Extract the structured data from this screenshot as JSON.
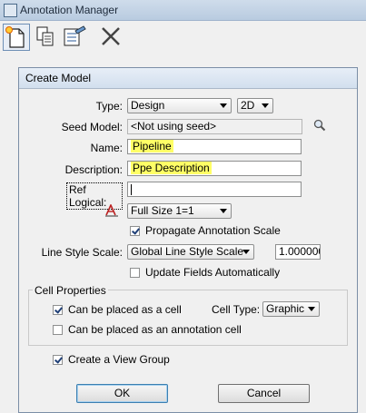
{
  "window": {
    "title": "Annotation Manager"
  },
  "toolbar": {
    "icons": [
      "new-model-icon",
      "copy-model-icon",
      "properties-icon",
      "delete-icon"
    ]
  },
  "dialog": {
    "title": "Create Model",
    "type": {
      "label": "Type:",
      "value": "Design",
      "dim": "2D"
    },
    "seed": {
      "label": "Seed Model:",
      "value": "<Not using seed>"
    },
    "name": {
      "label": "Name:",
      "value": "Pipeline"
    },
    "description": {
      "label": "Description:",
      "value": "Ppe Description"
    },
    "ref_logical": {
      "label": "Ref Logical:",
      "value": ""
    },
    "annotation_scale": {
      "value": "Full Size 1=1"
    },
    "propagate": {
      "label": "Propagate Annotation Scale",
      "checked": true
    },
    "line_style": {
      "label": "Line Style Scale:",
      "value": "Global Line Style Scale",
      "number": "1.000000"
    },
    "update_fields": {
      "label": "Update Fields Automatically",
      "checked": false
    },
    "cell_properties": {
      "title": "Cell Properties",
      "can_be_cell": {
        "label": "Can be placed as a cell",
        "checked": true
      },
      "cell_type": {
        "label": "Cell Type:",
        "value": "Graphic"
      },
      "annotation_cell": {
        "label": "Can be placed as an annotation cell",
        "checked": false
      }
    },
    "view_group": {
      "label": "Create a View Group",
      "checked": true
    },
    "ok": "OK",
    "cancel": "Cancel"
  },
  "colors": {
    "highlight": "#ffff66",
    "titlebar": "#c7d6e8"
  }
}
